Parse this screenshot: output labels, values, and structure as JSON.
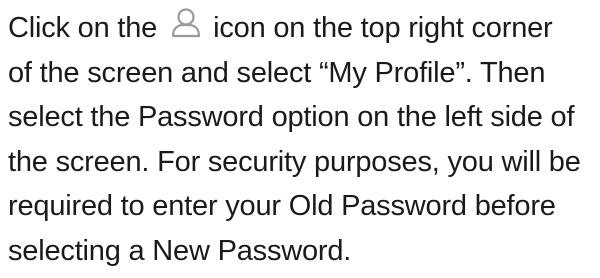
{
  "instructions": {
    "line1_before_icon": "Click on the",
    "icon": "user-profile-icon",
    "icon_color": "#9a9a9a",
    "line1_after_icon": "icon on the top right corner",
    "line2": "of the screen and select “My Profile”.  Then",
    "line3": "select the Password option on the left side of",
    "line4": "the screen.  For security purposes, you will be",
    "line5": "required to enter your Old Password before",
    "line6": "selecting a New Password."
  }
}
